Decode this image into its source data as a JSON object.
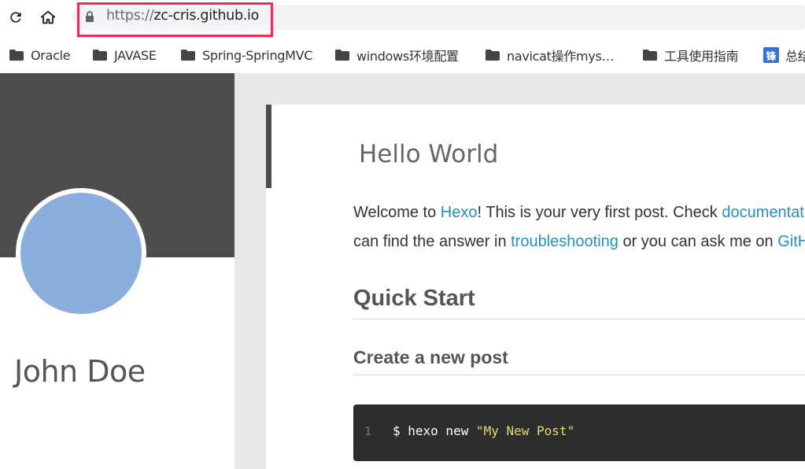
{
  "browser": {
    "url_protocol": "https://",
    "url_host": "zc-cris.github.io"
  },
  "bookmarks": [
    {
      "label": "Oracle",
      "icon": "folder-icon"
    },
    {
      "label": "JAVASE",
      "icon": "folder-icon"
    },
    {
      "label": "Spring-SpringMVC",
      "icon": "folder-icon"
    },
    {
      "label": "windows环境配置",
      "icon": "folder-icon"
    },
    {
      "label": "navicat操作mys…",
      "icon": "folder-icon"
    },
    {
      "label": "工具使用指南",
      "icon": "folder-icon"
    },
    {
      "label": "总结",
      "icon": "feng-icon",
      "icon_text": "锋"
    }
  ],
  "sidebar": {
    "author": "John Doe"
  },
  "article": {
    "title": "Hello World",
    "para1": {
      "t1": "Welcome to ",
      "link1": "Hexo",
      "t2": "! This is your very first post. Check ",
      "link2": "documentation"
    },
    "para2": {
      "t1": "can find the answer in ",
      "link1": "troubleshooting",
      "t2": " or you can ask me on ",
      "link2": "GitHub"
    },
    "h_quick": "Quick Start",
    "h_create": "Create a new post",
    "code": {
      "line_number": "1",
      "cmd": "$ hexo new ",
      "arg": "\"My New Post\""
    }
  },
  "colors": {
    "url_highlight": "#ea2f55",
    "link": "#258fb8",
    "banner": "#4d4d4d",
    "avatar": "#8aaede",
    "code_bg": "#2d2d2d",
    "code_string": "#e6db74"
  }
}
